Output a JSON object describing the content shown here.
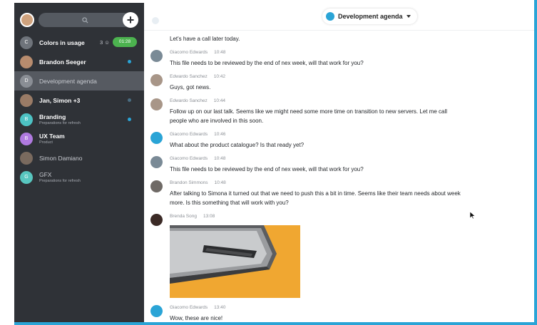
{
  "sidebar": {
    "items": [
      {
        "name": "Colors in usage",
        "letter": "C",
        "members": "3",
        "call": "01:28"
      },
      {
        "name": "Brandon Seeger"
      },
      {
        "name": "Development agenda",
        "letter": "D"
      },
      {
        "name": "Jan, Simon +3"
      },
      {
        "name": "Branding",
        "letter": "B",
        "sub": "Preparations for refresh"
      },
      {
        "name": "UX Team",
        "letter": "B",
        "sub": "Product"
      },
      {
        "name": "Simon Damiano"
      },
      {
        "name": "GFX",
        "letter": "G",
        "sub": "Preparations for refresh"
      }
    ]
  },
  "header": {
    "channel": "Development agenda"
  },
  "messages": {
    "top": "Let's have a call later today.",
    "list": [
      {
        "author": "Giacomo Edwards",
        "time": "10:48",
        "text": "This file needs to be reviewed by the end of nex week, will that work for you?"
      },
      {
        "author": "Edwardo Sanchez",
        "time": "10:42",
        "text": "Guys, got news."
      },
      {
        "author": "Edwardo Sanchez",
        "time": "10:44",
        "text": "Follow up on our last talk. Seems like we might need some more time on transition to new servers. Let me call people who are involved in this soon."
      },
      {
        "author": "Giacomo Edwards",
        "time": "10:46",
        "text": "What about the product catalogue? Is that ready yet?"
      },
      {
        "author": "Giacomo Edwards",
        "time": "10:48",
        "text": "This file needs to be reviewed by the end of nex week, will that work for you?"
      },
      {
        "author": "Brandon Simmons",
        "time": "10:48",
        "text": "After talking to Simona it turned out that we need to push this a bit in time. Seems like their team needs about week more. Is this something that will work with you?"
      },
      {
        "author": "Brenda Song",
        "time": "13:08",
        "text": ""
      },
      {
        "author": "Giacomo Edwards",
        "time": "13:40",
        "text": "Wow, these are nice!"
      }
    ]
  },
  "colors": {
    "accent": "#2aa4d6",
    "sidebar": "#2f3237",
    "call": "#4cb34f",
    "image_bg": "#f0a731"
  }
}
